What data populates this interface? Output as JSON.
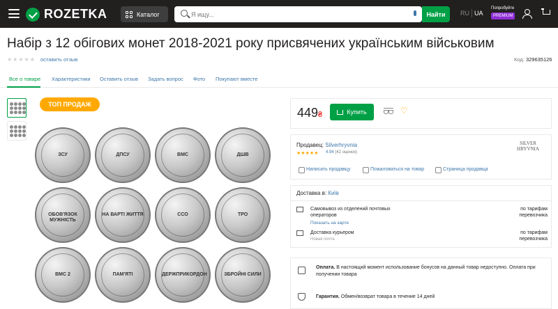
{
  "header": {
    "logo_text": "ROZETKA",
    "catalog_label": "Каталог",
    "search_placeholder": "Я ищу...",
    "find_label": "Найти",
    "lang_ru": "RU",
    "lang_ua": "UA",
    "premium_top": "Попробуйте",
    "premium_badge": "PREMIUM"
  },
  "product": {
    "title": "Набір з 12 обігових монет 2018-2021 року присвячених українським військовим",
    "leave_review": "оставить отзыв",
    "code_label": "Код:",
    "code_value": "329635126",
    "badge": "ТОП ПРОДАЖ",
    "price": "449",
    "currency": "₴",
    "buy_label": "Купить"
  },
  "tabs": [
    "Все о товаре",
    "Характеристики",
    "Оставить отзыв",
    "Задать вопрос",
    "Фото",
    "Покупают вместе"
  ],
  "seller": {
    "label": "Продавец:",
    "name": "Silverhryvnia",
    "rating": "4.94",
    "reviews": "(42 оценок)",
    "logo_line1": "SILVER",
    "logo_line2": "HRYVNIA",
    "links": [
      "Написать продавцу",
      "Пожаловаться на товар",
      "Страница продавца"
    ]
  },
  "delivery": {
    "title": "Доставка в:",
    "city": "Київ",
    "options": [
      {
        "name": "Самовывоз из отделений почтовых операторов",
        "sub": "Показать на карте",
        "price": "по тарифам перевозчика"
      },
      {
        "name": "Доставка курьером",
        "sub": "Новая почта",
        "price": "по тарифам перевозчика"
      }
    ]
  },
  "info": {
    "payment_label": "Оплата.",
    "payment_text": "В настоящий момент использование бонусов на данный товар недоступно. Оплата при получении товара",
    "warranty_label": "Гарантия.",
    "warranty_text": "Обмен/возврат товара в течение 14 дней"
  },
  "coins": [
    "ЗСУ",
    "ДПСУ",
    "ВМС",
    "ДШВ",
    "ОБОВ'ЯЗОК МУЖНІСТЬ",
    "НА ВАРТІ ЖИТТЯ",
    "ССО",
    "ТРО",
    "ВМС 2",
    "ПАМ'ЯТІ",
    "ДЕРЖПРИКОРДОН",
    "ЗБРОЙНІ СИЛИ"
  ]
}
